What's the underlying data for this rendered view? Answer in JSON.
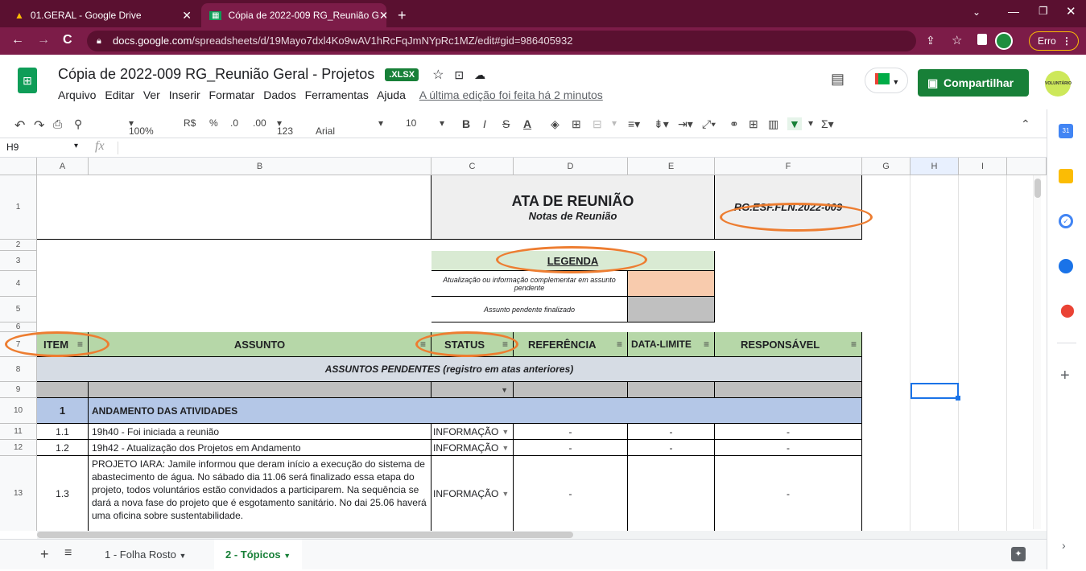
{
  "browser": {
    "tabs": [
      {
        "label": "01.GERAL - Google Drive",
        "active": false
      },
      {
        "label": "Cópia de 2022-009 RG_Reunião G",
        "active": true
      }
    ],
    "new_tab": "+",
    "url_host": "docs.google.com",
    "url_path": "/spreadsheets/d/19Mayo7dxl4Ko9wAV1hRcFqJmNYpRc1MZ/edit#gid=986405932",
    "error_label": "Erro",
    "avatar_text": "VOLUNTÁRIO"
  },
  "doc": {
    "title": "Cópia de 2022-009 RG_Reunião Geral - Projetos",
    "badge": ".XLSX",
    "menu": [
      "Arquivo",
      "Editar",
      "Ver",
      "Inserir",
      "Formatar",
      "Dados",
      "Ferramentas",
      "Ajuda"
    ],
    "last_edit": "A última edição foi feita há 2 minutos",
    "share_label": "Compartilhar",
    "avatar_text": "VOLUNTÁRIO"
  },
  "toolbar": {
    "zoom": "100%",
    "currency": "R$",
    "percent": "%",
    "dec_less": ".0",
    "dec_more": ".00",
    "format": "123",
    "font": "Arial",
    "font_size": "10"
  },
  "formula_bar": {
    "cell_ref": "H9",
    "fx": "fx",
    "value": ""
  },
  "columns": [
    "A",
    "B",
    "C",
    "D",
    "E",
    "F",
    "G",
    "H",
    "I"
  ],
  "rows": [
    "1",
    "2",
    "3",
    "4",
    "5",
    "6",
    "7",
    "8",
    "9",
    "10",
    "11",
    "12",
    "13"
  ],
  "sheet": {
    "title": "ATA DE REUNIÃO",
    "subtitle": "Notas de Reunião",
    "code": "RG.ESF.FLN.2022-009",
    "legend_title": "LEGENDA",
    "legend_1": "Atualização ou informação complementar em assunto pendente",
    "legend_2": "Assunto pendente finalizado",
    "headers": {
      "item": "ITEM",
      "assunto": "ASSUNTO",
      "status": "STATUS",
      "referencia": "REFERÊNCIA",
      "data_limite": "DATA-LIMITE",
      "responsavel": "RESPONSÁVEL"
    },
    "pending_header": "ASSUNTOS PENDENTES (registro em atas anteriores)",
    "section_num": "1",
    "section_title": "ANDAMENTO DAS ATIVIDADES",
    "items": [
      {
        "item": "1.1",
        "assunto": "19h40 - Foi iniciada a reunião",
        "status": "INFORMAÇÃO",
        "ref": "-",
        "data": "-",
        "resp": "-"
      },
      {
        "item": "1.2",
        "assunto": "19h42 - Atualização dos Projetos em Andamento",
        "status": "INFORMAÇÃO",
        "ref": "-",
        "data": "-",
        "resp": "-"
      },
      {
        "item": "1.3",
        "assunto": "PROJETO IARA: Jamile informou que deram início a execução do sistema de abastecimento de água. No sábado dia 11.06 será finalizado essa etapa do projeto, todos voluntários estão convidados a participarem. Na sequência se dará a nova fase do projeto que é esgotamento sanitário. No dai 25.06 haverá uma oficina sobre sustentabilidade.",
        "status": "INFORMAÇÃO",
        "ref": "-",
        "data": "",
        "resp": "-"
      }
    ]
  },
  "sheet_tabs": [
    {
      "label": "1 - Folha Rosto",
      "active": false
    },
    {
      "label": "2 - Tópicos",
      "active": true
    }
  ],
  "colors": {
    "accent": "#188038",
    "highlight": "#ed7d31",
    "chrome": "#7c1c48"
  }
}
